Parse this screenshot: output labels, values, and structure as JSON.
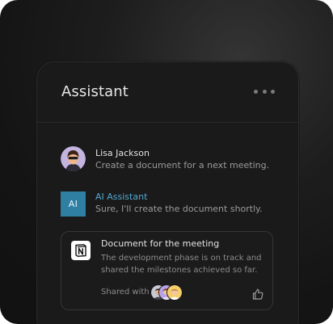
{
  "panel": {
    "title": "Assistant"
  },
  "messages": [
    {
      "name": "Lisa Jackson",
      "text": "Create a document for a next meeting."
    },
    {
      "badge": "AI",
      "name": "AI Assistant",
      "text": "Sure, I'll create the document shortly."
    }
  ],
  "document": {
    "title": "Document for the meeting",
    "description": "The development phase is on track and shared the milestones achieved so far.",
    "shared_label": "Shared with"
  },
  "colors": {
    "accent": "#52a8d2",
    "ai_badge": "#2f7fa3"
  },
  "icons": {
    "more": "more-horizontal-icon",
    "notion": "notion-logo-icon",
    "like": "thumbs-up-icon"
  }
}
